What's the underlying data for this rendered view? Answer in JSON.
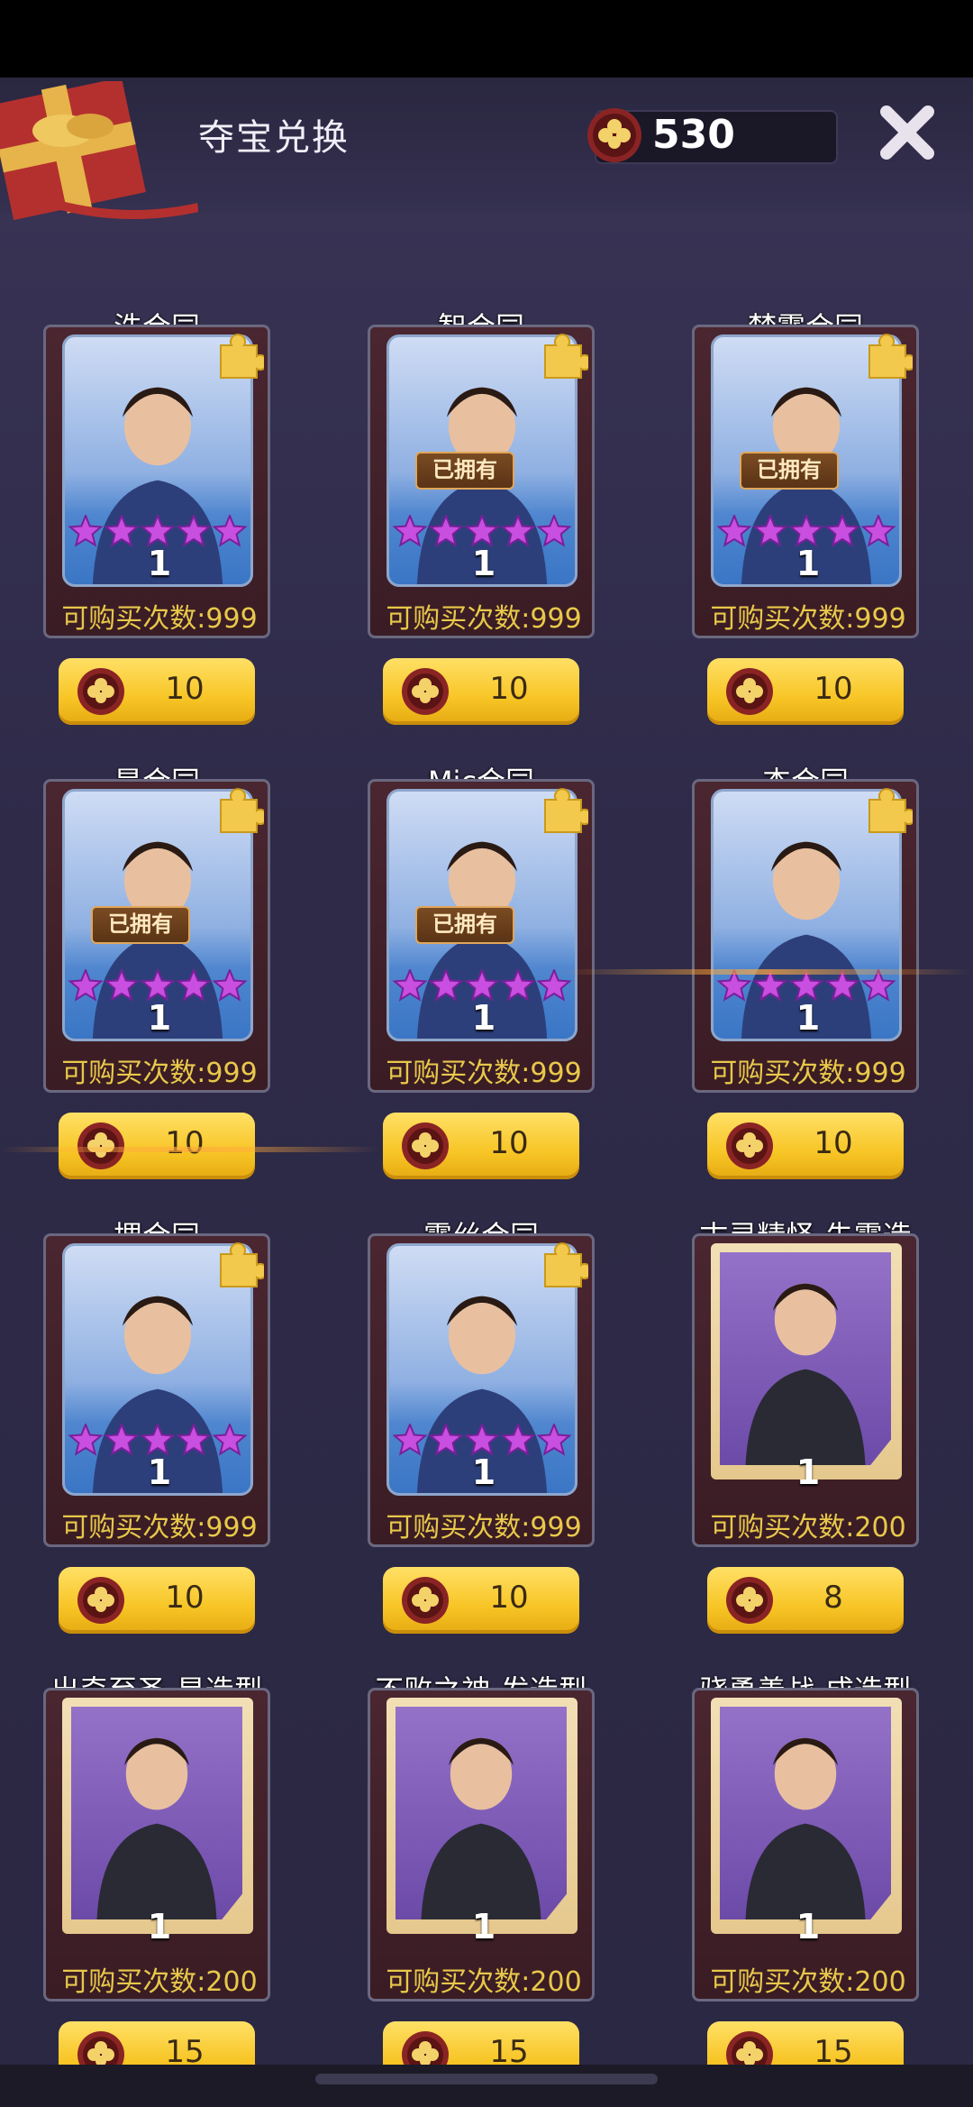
{
  "header": {
    "title": "夺宝兑换",
    "coin_balance": "530"
  },
  "colors": {
    "accent_gold": "#f7c525",
    "buy_count_text": "#e8c84a",
    "star_purple": "#c84fe0",
    "background": "#2e2a48"
  },
  "cards": [
    {
      "name": "洙合同",
      "type": "contract",
      "owned": false,
      "stars": 5,
      "count": "1",
      "buy_label": "可购买次数:999",
      "price": "10"
    },
    {
      "name": "智合同",
      "type": "contract",
      "owned": true,
      "stars": 5,
      "count": "1",
      "buy_label": "可购买次数:999",
      "price": "10"
    },
    {
      "name": "梦露合同",
      "type": "contract",
      "owned": true,
      "stars": 5,
      "count": "1",
      "buy_label": "可购买次数:999",
      "price": "10"
    },
    {
      "name": "昊合同",
      "type": "contract",
      "owned": true,
      "stars": 5,
      "count": "1",
      "buy_label": "可购买次数:999",
      "price": "10"
    },
    {
      "name": "Mic合同",
      "type": "contract",
      "owned": true,
      "stars": 5,
      "count": "1",
      "buy_label": "可购买次数:999",
      "price": "10"
    },
    {
      "name": "杰合同",
      "type": "contract",
      "owned": false,
      "stars": 5,
      "count": "1",
      "buy_label": "可购买次数:999",
      "price": "10"
    },
    {
      "name": "堺合同",
      "type": "contract",
      "owned": false,
      "stars": 5,
      "count": "1",
      "buy_label": "可购买次数:999",
      "price": "10"
    },
    {
      "name": "露丝合同",
      "type": "contract",
      "owned": false,
      "stars": 5,
      "count": "1",
      "buy_label": "可购买次数:999",
      "price": "10"
    },
    {
      "name": "古灵精怪-朱霞造",
      "type": "style",
      "owned": false,
      "stars": 0,
      "count": "1",
      "buy_label": "可购买次数:200",
      "price": "8"
    },
    {
      "name": "出奇至圣-星造型",
      "type": "style",
      "owned": false,
      "stars": 0,
      "count": "1",
      "buy_label": "可购买次数:200",
      "price": "15"
    },
    {
      "name": "不败之神-发造型",
      "type": "style",
      "owned": false,
      "stars": 0,
      "count": "1",
      "buy_label": "可购买次数:200",
      "price": "15"
    },
    {
      "name": "骁勇善战-成造型",
      "type": "style",
      "owned": false,
      "stars": 0,
      "count": "1",
      "buy_label": "可购买次数:200",
      "price": "15"
    }
  ],
  "labels": {
    "owned": "已拥有"
  },
  "icons": {
    "coin": "clover-coin-icon",
    "close": "close-icon",
    "fragment": "puzzle-piece-icon",
    "star": "star-icon",
    "gift": "gift-box-icon"
  }
}
